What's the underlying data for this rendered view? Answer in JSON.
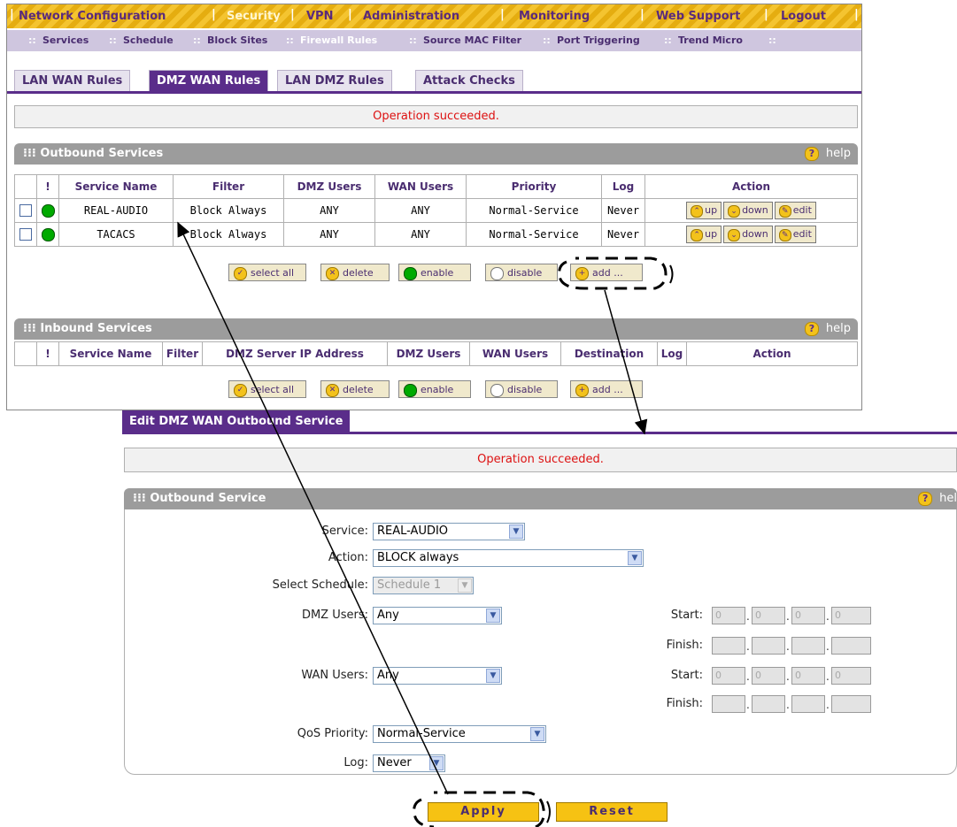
{
  "main_nav": [
    "Network Configuration",
    "Security",
    "VPN",
    "Administration",
    "Monitoring",
    "Web Support",
    "Logout"
  ],
  "sub_nav": [
    "Services",
    "Schedule",
    "Block Sites",
    "Firewall Rules",
    "Source MAC Filter",
    "Port Triggering",
    "Trend Micro"
  ],
  "tabs": [
    "LAN WAN Rules",
    "DMZ WAN Rules",
    "LAN DMZ Rules",
    "Attack Checks"
  ],
  "status_message": "Operation succeeded.",
  "help_label": "help",
  "outbound": {
    "title": "Outbound Services",
    "columns": [
      "!",
      "Service Name",
      "Filter",
      "DMZ Users",
      "WAN Users",
      "Priority",
      "Log",
      "Action"
    ],
    "rows": [
      {
        "service": "REAL-AUDIO",
        "filter": "Block Always",
        "dmz": "ANY",
        "wan": "ANY",
        "priority": "Normal-Service",
        "log": "Never"
      },
      {
        "service": "TACACS",
        "filter": "Block Always",
        "dmz": "ANY",
        "wan": "ANY",
        "priority": "Normal-Service",
        "log": "Never"
      }
    ],
    "row_actions": [
      "up",
      "down",
      "edit"
    ]
  },
  "buttons": {
    "select_all": "select all",
    "delete": "delete",
    "enable": "enable",
    "disable": "disable",
    "add": "add ..."
  },
  "inbound": {
    "title": "Inbound Services",
    "columns": [
      "!",
      "Service Name",
      "Filter",
      "DMZ Server IP Address",
      "DMZ Users",
      "WAN Users",
      "Destination",
      "Log",
      "Action"
    ]
  },
  "edit": {
    "tab": "Edit DMZ WAN Outbound Service",
    "message": "Operation succeeded.",
    "section": "Outbound Service",
    "help": "hel",
    "service_label": "Service:",
    "service_value": "REAL-AUDIO",
    "action_label": "Action:",
    "action_value": "BLOCK always",
    "schedule_label": "Select Schedule:",
    "schedule_value": "Schedule 1",
    "dmz_users_label": "DMZ Users:",
    "dmz_users_value": "Any",
    "wan_users_label": "WAN Users:",
    "wan_users_value": "Any",
    "start_label": "Start:",
    "finish_label": "Finish:",
    "ip_zero": "0",
    "qos_label": "QoS Priority:",
    "qos_value": "Normal-Service",
    "log_label": "Log:",
    "log_value": "Never",
    "apply": "Apply",
    "reset": "Reset"
  },
  "colors": {
    "brand_purple": "#5a2d8a",
    "nav_gold": "#f4c430",
    "error_red": "#dd1111",
    "enable_green": "#00aa00"
  }
}
